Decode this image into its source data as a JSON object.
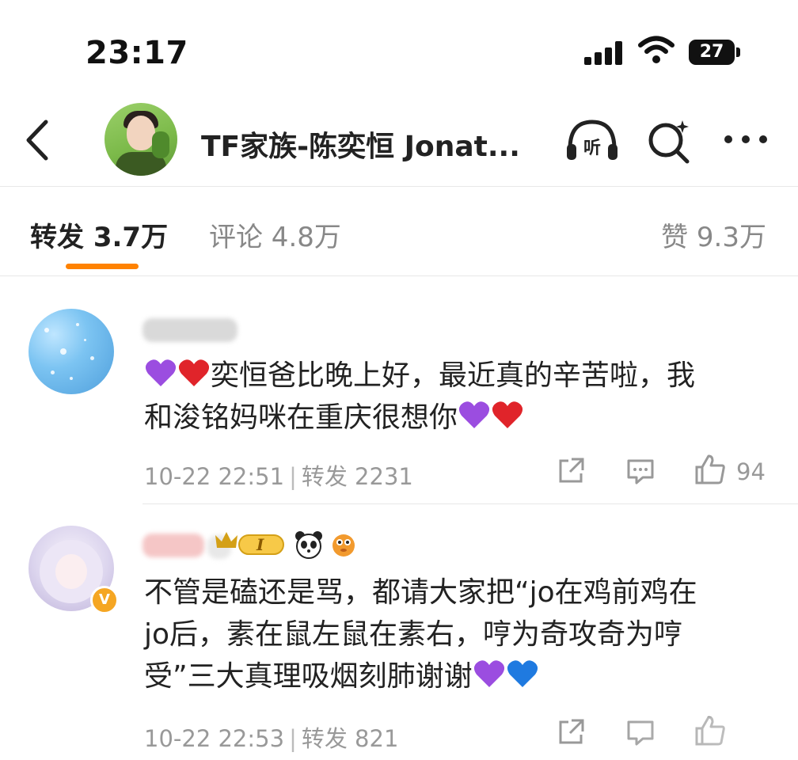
{
  "status_bar": {
    "time": "23:17",
    "battery": "27"
  },
  "header": {
    "title": "TF家族-陈奕恒 Jonat...",
    "icons": [
      "back-icon",
      "listen-icon",
      "search-icon",
      "more-icon"
    ],
    "listen_label": "听"
  },
  "tabs": {
    "reposts": "转发 3.7万",
    "comments": "评论 4.8万",
    "likes": "赞 9.3万"
  },
  "accent_color": "#ff8200",
  "comments": [
    {
      "line1": "奕恒爸比晚上好，最近真的辛苦啦，我",
      "line2": "和浚铭妈咪在重庆很想你",
      "meta_time": "10-22 22:51",
      "meta_repost": "转发 2231",
      "likes": "94"
    },
    {
      "badge_level": "I",
      "avatar_badge": "V",
      "line1": "不管是磕还是骂，都请大家把“jo在鸡前鸡在",
      "line2": "jo后，素在鼠左鼠在素右，哼为奇攻奇为哼",
      "line3": "受”三大真理吸烟刻肺谢谢",
      "meta_time": "10-22 22:53",
      "meta_repost": "转发 821"
    }
  ]
}
